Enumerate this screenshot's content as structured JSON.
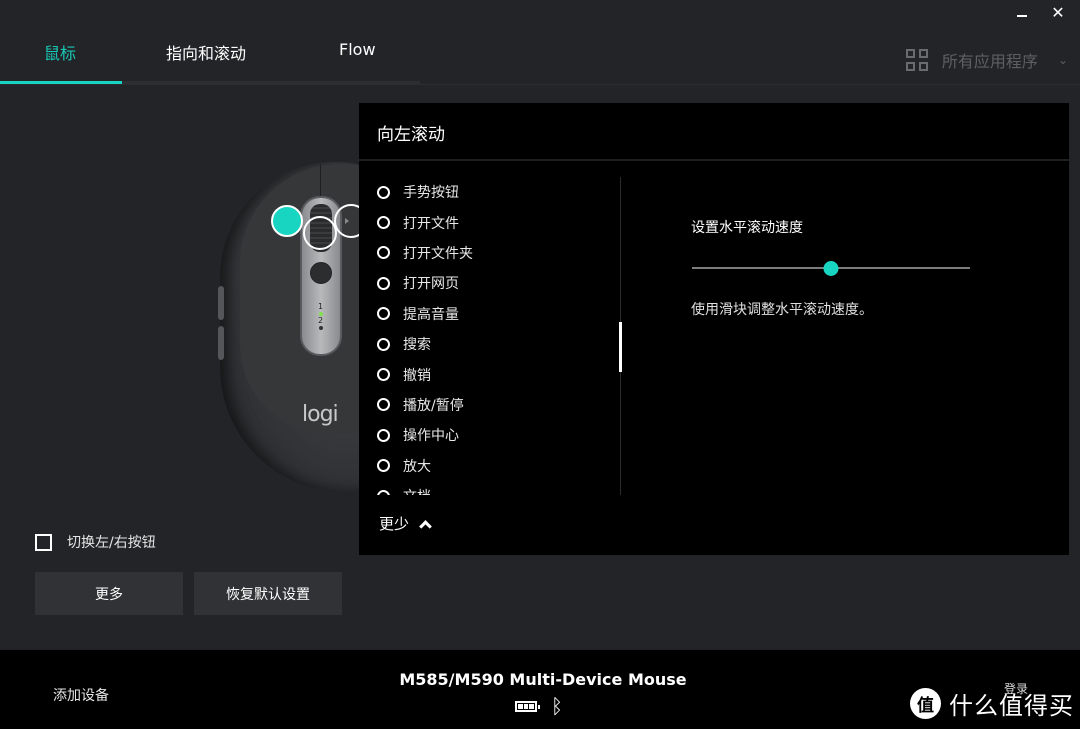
{
  "window": {
    "minimize_label": "_",
    "close_label": "✕"
  },
  "tabs": [
    {
      "label": "鼠标",
      "active": true
    },
    {
      "label": "指向和滚动",
      "active": false
    },
    {
      "label": "Flow",
      "active": false
    }
  ],
  "apps_selector": {
    "icon": "grid-icon",
    "label": "所有应用程序",
    "chevron": "⌄"
  },
  "mouse": {
    "logo": "logi",
    "channel_1": "1",
    "channel_2": "2",
    "highlight_color": "#18d5c2",
    "selected_hotspot": "left-scroll"
  },
  "left_controls": {
    "swap_buttons_label": "切换左/右按钮",
    "swap_buttons_checked": false,
    "more_button": "更多",
    "restore_defaults_button": "恢复默认设置"
  },
  "panel": {
    "title": "向左滚动",
    "actions": [
      {
        "label": "手势按钮"
      },
      {
        "label": "打开文件"
      },
      {
        "label": "打开文件夹"
      },
      {
        "label": "打开网页"
      },
      {
        "label": "提高音量"
      },
      {
        "label": "搜索"
      },
      {
        "label": "撤销"
      },
      {
        "label": "播放/暂停"
      },
      {
        "label": "操作中心"
      },
      {
        "label": "放大"
      },
      {
        "label": "文档"
      }
    ],
    "less_label": "更少",
    "setting": {
      "title": "设置水平滚动速度",
      "slider_value_fraction": 0.5,
      "description": "使用滑块调整水平滚动速度。"
    }
  },
  "footer": {
    "add_device": "添加设备",
    "device_name": "M585/M590 Multi-Device Mouse",
    "battery_icon": "battery-full-icon",
    "connection_icon": "bluetooth-icon",
    "bluetooth_glyph": "ᛒ",
    "login": "登录"
  },
  "watermark": {
    "badge": "值",
    "text": "什么值得买"
  },
  "colors": {
    "accent": "#18d5c2",
    "background": "#232427",
    "panel": "#000000",
    "button": "#313235"
  }
}
